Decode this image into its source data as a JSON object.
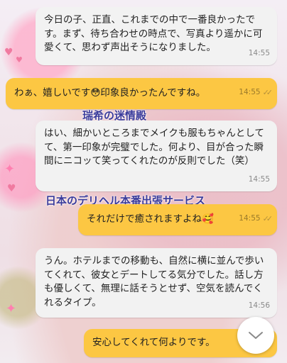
{
  "messages": [
    {
      "text": "今日の子、正直、これまでの中で一番良かったです。まず、待ち合わせの時点で、写真より遥かに可愛くて、思わず声出そうになりました。",
      "time": "14:55",
      "direction": "incoming"
    },
    {
      "text": "わぁ、嬉しいです",
      "emoji": "😳",
      "text_after": "印象良かったんですね。",
      "time": "14:55",
      "direction": "outgoing",
      "read": true
    },
    {
      "text": "はい、細かいところまでメイクも服もちゃんとしてて、第一印象が完璧でした。何より、目が合った瞬間にニコッて笑ってくれたのが反則でした（笑）",
      "time": "14:55",
      "direction": "incoming"
    },
    {
      "text": "それだけで癒されますよね",
      "emoji": "🥰",
      "time": "14:55",
      "direction": "outgoing",
      "read": true
    },
    {
      "text": "うん。ホテルまでの移動も、自然に横に並んで歩いてくれて、彼女とデートしてる気分でした。話し方も優しくて、無理に話そうとせず、空気を読んでくれるタイプ。",
      "time": "14:56",
      "direction": "incoming"
    },
    {
      "text": "安心してくれて何よりです。",
      "direction": "outgoing"
    }
  ],
  "wallpaper": {
    "overlay_text_1": "瑞希の迷情殿",
    "overlay_text_2": "日本のデリヘル本番出張サービス"
  },
  "icons": {
    "read_receipt": "double-check-icon",
    "scroll_down": "chevron-down-icon"
  },
  "colors": {
    "outgoing_bubble": "#fcc743",
    "incoming_bubble": "#f2f2f2",
    "wallpaper_text": "#3a3a9a"
  }
}
